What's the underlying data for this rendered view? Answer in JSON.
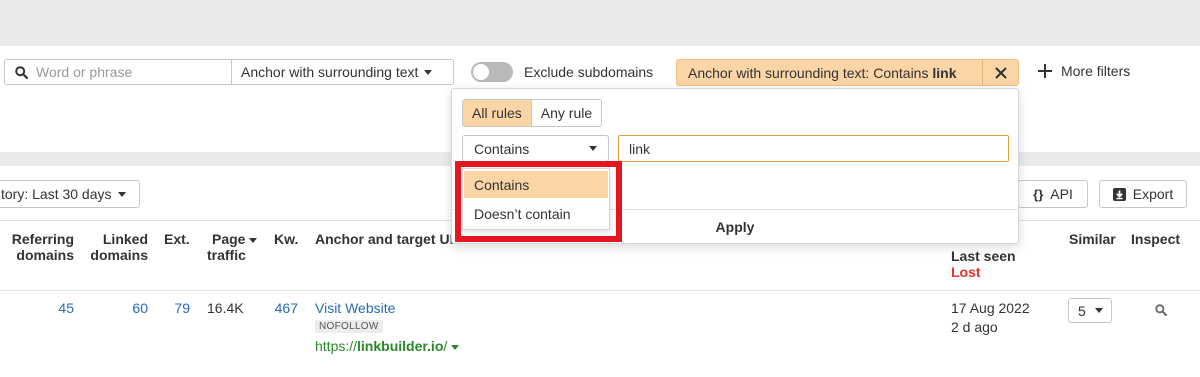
{
  "filters": {
    "search": {
      "placeholder": "Word or phrase",
      "value": ""
    },
    "mode_select": {
      "value": "Anchor with surrounding text"
    },
    "exclude_subdomains": {
      "label": "Exclude subdomains",
      "on": false
    },
    "active_filter": {
      "prefix": "Anchor with surrounding text: Contains ",
      "term": "link"
    },
    "more_filters_label": "More filters"
  },
  "popover": {
    "tabs": [
      "All rules",
      "Any rule"
    ],
    "active_tab": "All rules",
    "operator": "Contains",
    "value": "link",
    "apply_label": "Apply",
    "options": [
      "Contains",
      "Doesn’t contain"
    ],
    "selected_option": "Contains"
  },
  "toolbar": {
    "history_label": "tory: Last 30 days",
    "api_label": "API",
    "export_label": "Export"
  },
  "table": {
    "headers": {
      "referring_domains": [
        "Referring",
        "domains"
      ],
      "linked_domains": [
        "Linked",
        "domains"
      ],
      "ext": "Ext.",
      "page_traffic": [
        "Page",
        "traffic"
      ],
      "kw": "Kw.",
      "anchor": "Anchor and target UF",
      "last_seen": "Last seen",
      "last_seen_status": "Lost",
      "similar": "Similar",
      "inspect": "Inspect"
    },
    "rows": [
      {
        "referring_domains": "45",
        "linked_domains": "60",
        "ext": "79",
        "page_traffic": "16.4K",
        "kw": "467",
        "anchor_text": "Visit Website",
        "tag": "NOFOLLOW",
        "url_prefix": "https://",
        "url_domain": "linkbuilder.io",
        "url_suffix": "/",
        "last_seen_date": "17 Aug 2022",
        "last_seen_ago": "2 d ago",
        "similar": "5"
      }
    ]
  },
  "colors": {
    "accent_fill": "#fbd5a5",
    "link_blue": "#2a6bb6",
    "url_green": "#2a8a2a",
    "lost_red": "#e5312a",
    "highlight_red": "#e3171d"
  }
}
